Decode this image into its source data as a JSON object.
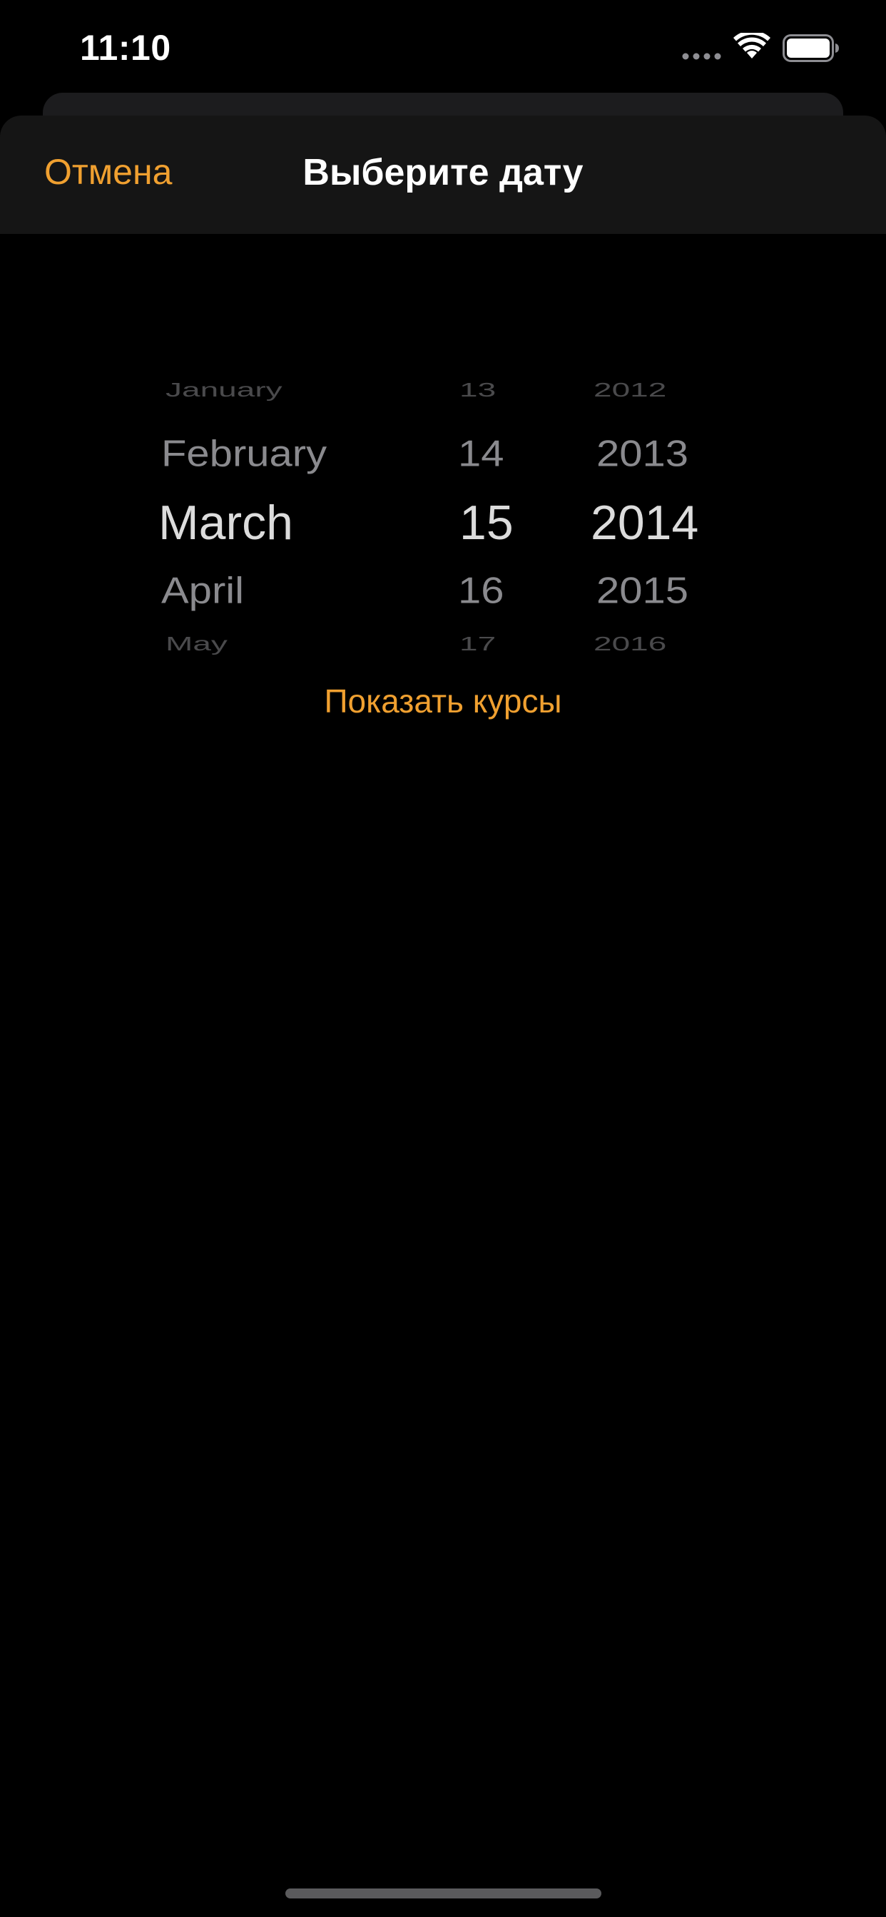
{
  "status_bar": {
    "time": "11:10",
    "icons": [
      "cellular-signal-icon",
      "wifi-icon",
      "battery-icon"
    ]
  },
  "nav": {
    "cancel_label": "Отмена",
    "title": "Выберите дату"
  },
  "date_picker": {
    "months": [
      "January",
      "February",
      "March",
      "April",
      "May"
    ],
    "days": [
      "13",
      "14",
      "15",
      "16",
      "17"
    ],
    "years": [
      "2012",
      "2013",
      "2014",
      "2015",
      "2016"
    ],
    "selected": {
      "month": "March",
      "day": "15",
      "year": "2014"
    }
  },
  "actions": {
    "show_rates_label": "Показать курсы"
  },
  "colors": {
    "accent": "#f0a030",
    "background": "#000000",
    "nav_background": "#151515"
  }
}
